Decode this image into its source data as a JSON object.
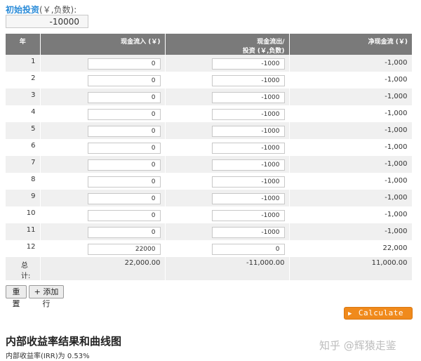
{
  "initial": {
    "label_link": "初始投资",
    "label_note": "(￥,负数):",
    "value": "-10000"
  },
  "table": {
    "headers": {
      "year": "年",
      "inflow": "现金流入 (￥)",
      "outflow_line1": "现金流出/",
      "outflow_line2": "投资 (￥,负数)",
      "net": "净现金流 (￥)"
    },
    "rows": [
      {
        "year": "1",
        "inflow": "0",
        "outflow": "-1000",
        "net": "-1,000"
      },
      {
        "year": "2",
        "inflow": "0",
        "outflow": "-1000",
        "net": "-1,000"
      },
      {
        "year": "3",
        "inflow": "0",
        "outflow": "-1000",
        "net": "-1,000"
      },
      {
        "year": "4",
        "inflow": "0",
        "outflow": "-1000",
        "net": "-1,000"
      },
      {
        "year": "5",
        "inflow": "0",
        "outflow": "-1000",
        "net": "-1,000"
      },
      {
        "year": "6",
        "inflow": "0",
        "outflow": "-1000",
        "net": "-1,000"
      },
      {
        "year": "7",
        "inflow": "0",
        "outflow": "-1000",
        "net": "-1,000"
      },
      {
        "year": "8",
        "inflow": "0",
        "outflow": "-1000",
        "net": "-1,000"
      },
      {
        "year": "9",
        "inflow": "0",
        "outflow": "-1000",
        "net": "-1,000"
      },
      {
        "year": "10",
        "inflow": "0",
        "outflow": "-1000",
        "net": "-1,000"
      },
      {
        "year": "11",
        "inflow": "0",
        "outflow": "-1000",
        "net": "-1,000"
      },
      {
        "year": "12",
        "inflow": "22000",
        "outflow": "0",
        "net": "22,000"
      }
    ],
    "totals": {
      "label": "总计:",
      "inflow": "22,000.00",
      "outflow": "-11,000.00",
      "net": "11,000.00"
    }
  },
  "buttons": {
    "reset": "重置",
    "add_row": "+ 添加行",
    "calculate": "Calculate",
    "calculate_icon": "play-triangle-icon"
  },
  "result": {
    "title": "内部收益率结果和曲线图",
    "irr_text": "内部收益率(IRR)为 0.53%"
  },
  "watermark": "知乎 @辉猿走鉴",
  "colors": {
    "header_bg": "#7a7a7a",
    "accent_link": "#2a8bd8",
    "calculate_bg": "#f08a1c"
  }
}
